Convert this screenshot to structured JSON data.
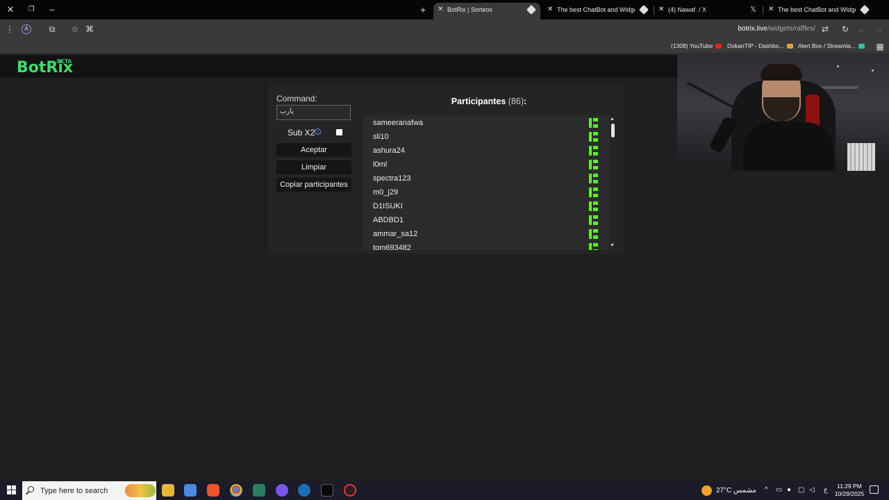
{
  "browser": {
    "tabs": [
      {
        "title": "BotRix | Sorteos",
        "active": true
      },
      {
        "title": "The best ChatBot and Widgets",
        "active": false
      },
      {
        "title": "(4) Nawaf. / X",
        "active": false
      },
      {
        "title": "The best ChatBot and Widgets",
        "active": false
      }
    ],
    "url_host": "botrix.live",
    "url_path": "/widgets/raffles/",
    "bookmarks": [
      {
        "label": "(1308) YouTube"
      },
      {
        "label": "DokanTIP - Dashbo..."
      },
      {
        "label": "Alert Box / Streamla..."
      }
    ]
  },
  "app": {
    "logo": "BotRix",
    "beta": "BETA"
  },
  "raffle": {
    "command_label": "Command:",
    "command_value": "يارب",
    "sub_label": "Sub X2",
    "sub_checked": false,
    "buttons": {
      "accept": "Aceptar",
      "clear": "Limpiar",
      "copy": "Copiar participantes"
    },
    "participants_title": "Participantes",
    "participants_count": "(86)",
    "participants_colon": ":",
    "participants": [
      "sameeranafwa",
      "sli10",
      "ashura24",
      "l0ml",
      "spectra123",
      "m0_j29",
      "D1ISUKI",
      "ABDBD1",
      "ammar_sa12",
      "tom693482"
    ],
    "platform_color": "#53fc18"
  },
  "taskbar": {
    "search_placeholder": "Type here to search",
    "temperature": "27°C",
    "condition": "مشمس",
    "lang": "ع",
    "time": "11:29 PM",
    "date": "10/29/2025"
  },
  "colors": {
    "accent_green": "#3ddc6b",
    "kick_green": "#53fc18",
    "page_bg": "#1f1f1f"
  }
}
